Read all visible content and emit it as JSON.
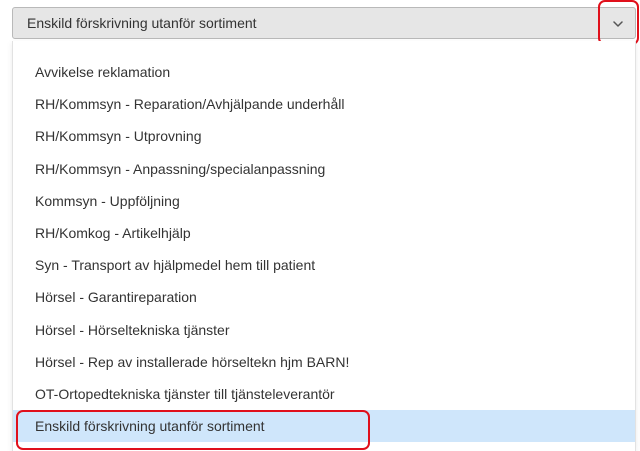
{
  "select": {
    "value": "Enskild förskrivning utanför sortiment",
    "icon": "chevron-down-icon"
  },
  "dropdown": {
    "options": [
      "Avvikelse reklamation",
      "RH/Kommsyn - Reparation/Avhjälpande underhåll",
      "RH/Kommsyn - Utprovning",
      "RH/Kommsyn - Anpassning/specialanpassning",
      "Kommsyn - Uppföljning",
      "RH/Komkog - Artikelhjälp",
      "Syn - Transport av hjälpmedel hem till patient",
      "Hörsel - Garantireparation",
      "Hörsel - Hörseltekniska tjänster",
      "Hörsel - Rep av installerade hörseltekn hjm BARN!",
      "OT-Ortopedtekniska tjänster till tjänsteleverantör",
      "Enskild förskrivning utanför sortiment"
    ],
    "selected_index": 11
  },
  "colors": {
    "highlight": "#e0101b",
    "selected_bg": "#cfe6fb",
    "select_bg": "#e6e6e6"
  }
}
